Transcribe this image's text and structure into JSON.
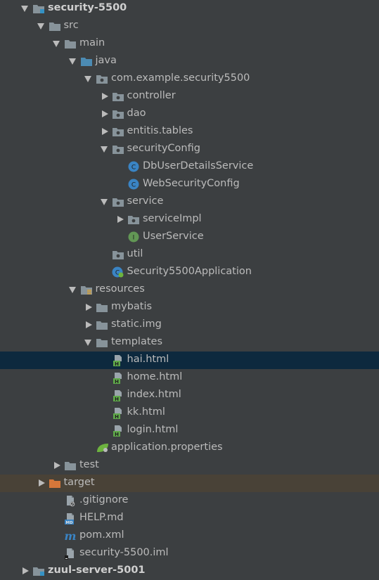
{
  "tree": [
    {
      "label": "security-5500",
      "depth": 0,
      "arrow": "down",
      "icon": "module-folder-icon",
      "bold": true
    },
    {
      "label": "src",
      "depth": 1,
      "arrow": "down",
      "icon": "folder-icon"
    },
    {
      "label": "main",
      "depth": 2,
      "arrow": "down",
      "icon": "folder-icon"
    },
    {
      "label": "java",
      "depth": 3,
      "arrow": "down",
      "icon": "source-root-folder-icon"
    },
    {
      "label": "com.example.security5500",
      "depth": 4,
      "arrow": "down",
      "icon": "package-icon"
    },
    {
      "label": "controller",
      "depth": 5,
      "arrow": "right",
      "icon": "package-icon"
    },
    {
      "label": "dao",
      "depth": 5,
      "arrow": "right",
      "icon": "package-icon"
    },
    {
      "label": "entitis.tables",
      "depth": 5,
      "arrow": "right",
      "icon": "package-icon"
    },
    {
      "label": "securityConfig",
      "depth": 5,
      "arrow": "down",
      "icon": "package-icon"
    },
    {
      "label": "DbUserDetailsService",
      "depth": 6,
      "arrow": "none",
      "icon": "class-icon"
    },
    {
      "label": "WebSecurityConfig",
      "depth": 6,
      "arrow": "none",
      "icon": "class-icon"
    },
    {
      "label": "service",
      "depth": 5,
      "arrow": "down",
      "icon": "package-icon"
    },
    {
      "label": "serviceImpl",
      "depth": 6,
      "arrow": "right",
      "icon": "package-icon"
    },
    {
      "label": "UserService",
      "depth": 6,
      "arrow": "none",
      "icon": "interface-icon"
    },
    {
      "label": "util",
      "depth": 5,
      "arrow": "none",
      "icon": "package-icon"
    },
    {
      "label": "Security5500Application",
      "depth": 5,
      "arrow": "none",
      "icon": "spring-boot-app-icon"
    },
    {
      "label": "resources",
      "depth": 3,
      "arrow": "down",
      "icon": "resources-folder-icon"
    },
    {
      "label": "mybatis",
      "depth": 4,
      "arrow": "right",
      "icon": "folder-icon"
    },
    {
      "label": "static.img",
      "depth": 4,
      "arrow": "right",
      "icon": "folder-icon"
    },
    {
      "label": "templates",
      "depth": 4,
      "arrow": "down",
      "icon": "folder-icon"
    },
    {
      "label": "hai.html",
      "depth": 5,
      "arrow": "none",
      "icon": "html-file-icon",
      "selected": true
    },
    {
      "label": "home.html",
      "depth": 5,
      "arrow": "none",
      "icon": "html-file-icon"
    },
    {
      "label": "index.html",
      "depth": 5,
      "arrow": "none",
      "icon": "html-file-icon"
    },
    {
      "label": "kk.html",
      "depth": 5,
      "arrow": "none",
      "icon": "html-file-icon"
    },
    {
      "label": "login.html",
      "depth": 5,
      "arrow": "none",
      "icon": "html-file-icon"
    },
    {
      "label": "application.properties",
      "depth": 4,
      "arrow": "none",
      "icon": "spring-properties-icon"
    },
    {
      "label": "test",
      "depth": 2,
      "arrow": "right",
      "icon": "folder-icon"
    },
    {
      "label": "target",
      "depth": 1,
      "arrow": "right",
      "icon": "excluded-folder-icon",
      "excluded": true
    },
    {
      "label": ".gitignore",
      "depth": 2,
      "arrow": "none",
      "icon": "gitignore-file-icon"
    },
    {
      "label": "HELP.md",
      "depth": 2,
      "arrow": "none",
      "icon": "markdown-file-icon"
    },
    {
      "label": "pom.xml",
      "depth": 2,
      "arrow": "none",
      "icon": "maven-file-icon"
    },
    {
      "label": "security-5500.iml",
      "depth": 2,
      "arrow": "none",
      "icon": "iml-file-icon"
    },
    {
      "label": "zuul-server-5001",
      "depth": 0,
      "arrow": "right",
      "icon": "module-folder-icon",
      "bold": true
    }
  ],
  "colors": {
    "background": "#3c3f41",
    "selected": "#0d293e",
    "excluded": "#494237",
    "text": "#bbbbbb",
    "folder": "#87939a",
    "source_root": "#4c8bb3",
    "class": "#3a84c4",
    "interface": "#629755",
    "html": "#5fa84a",
    "excluded_folder": "#d6773a"
  }
}
